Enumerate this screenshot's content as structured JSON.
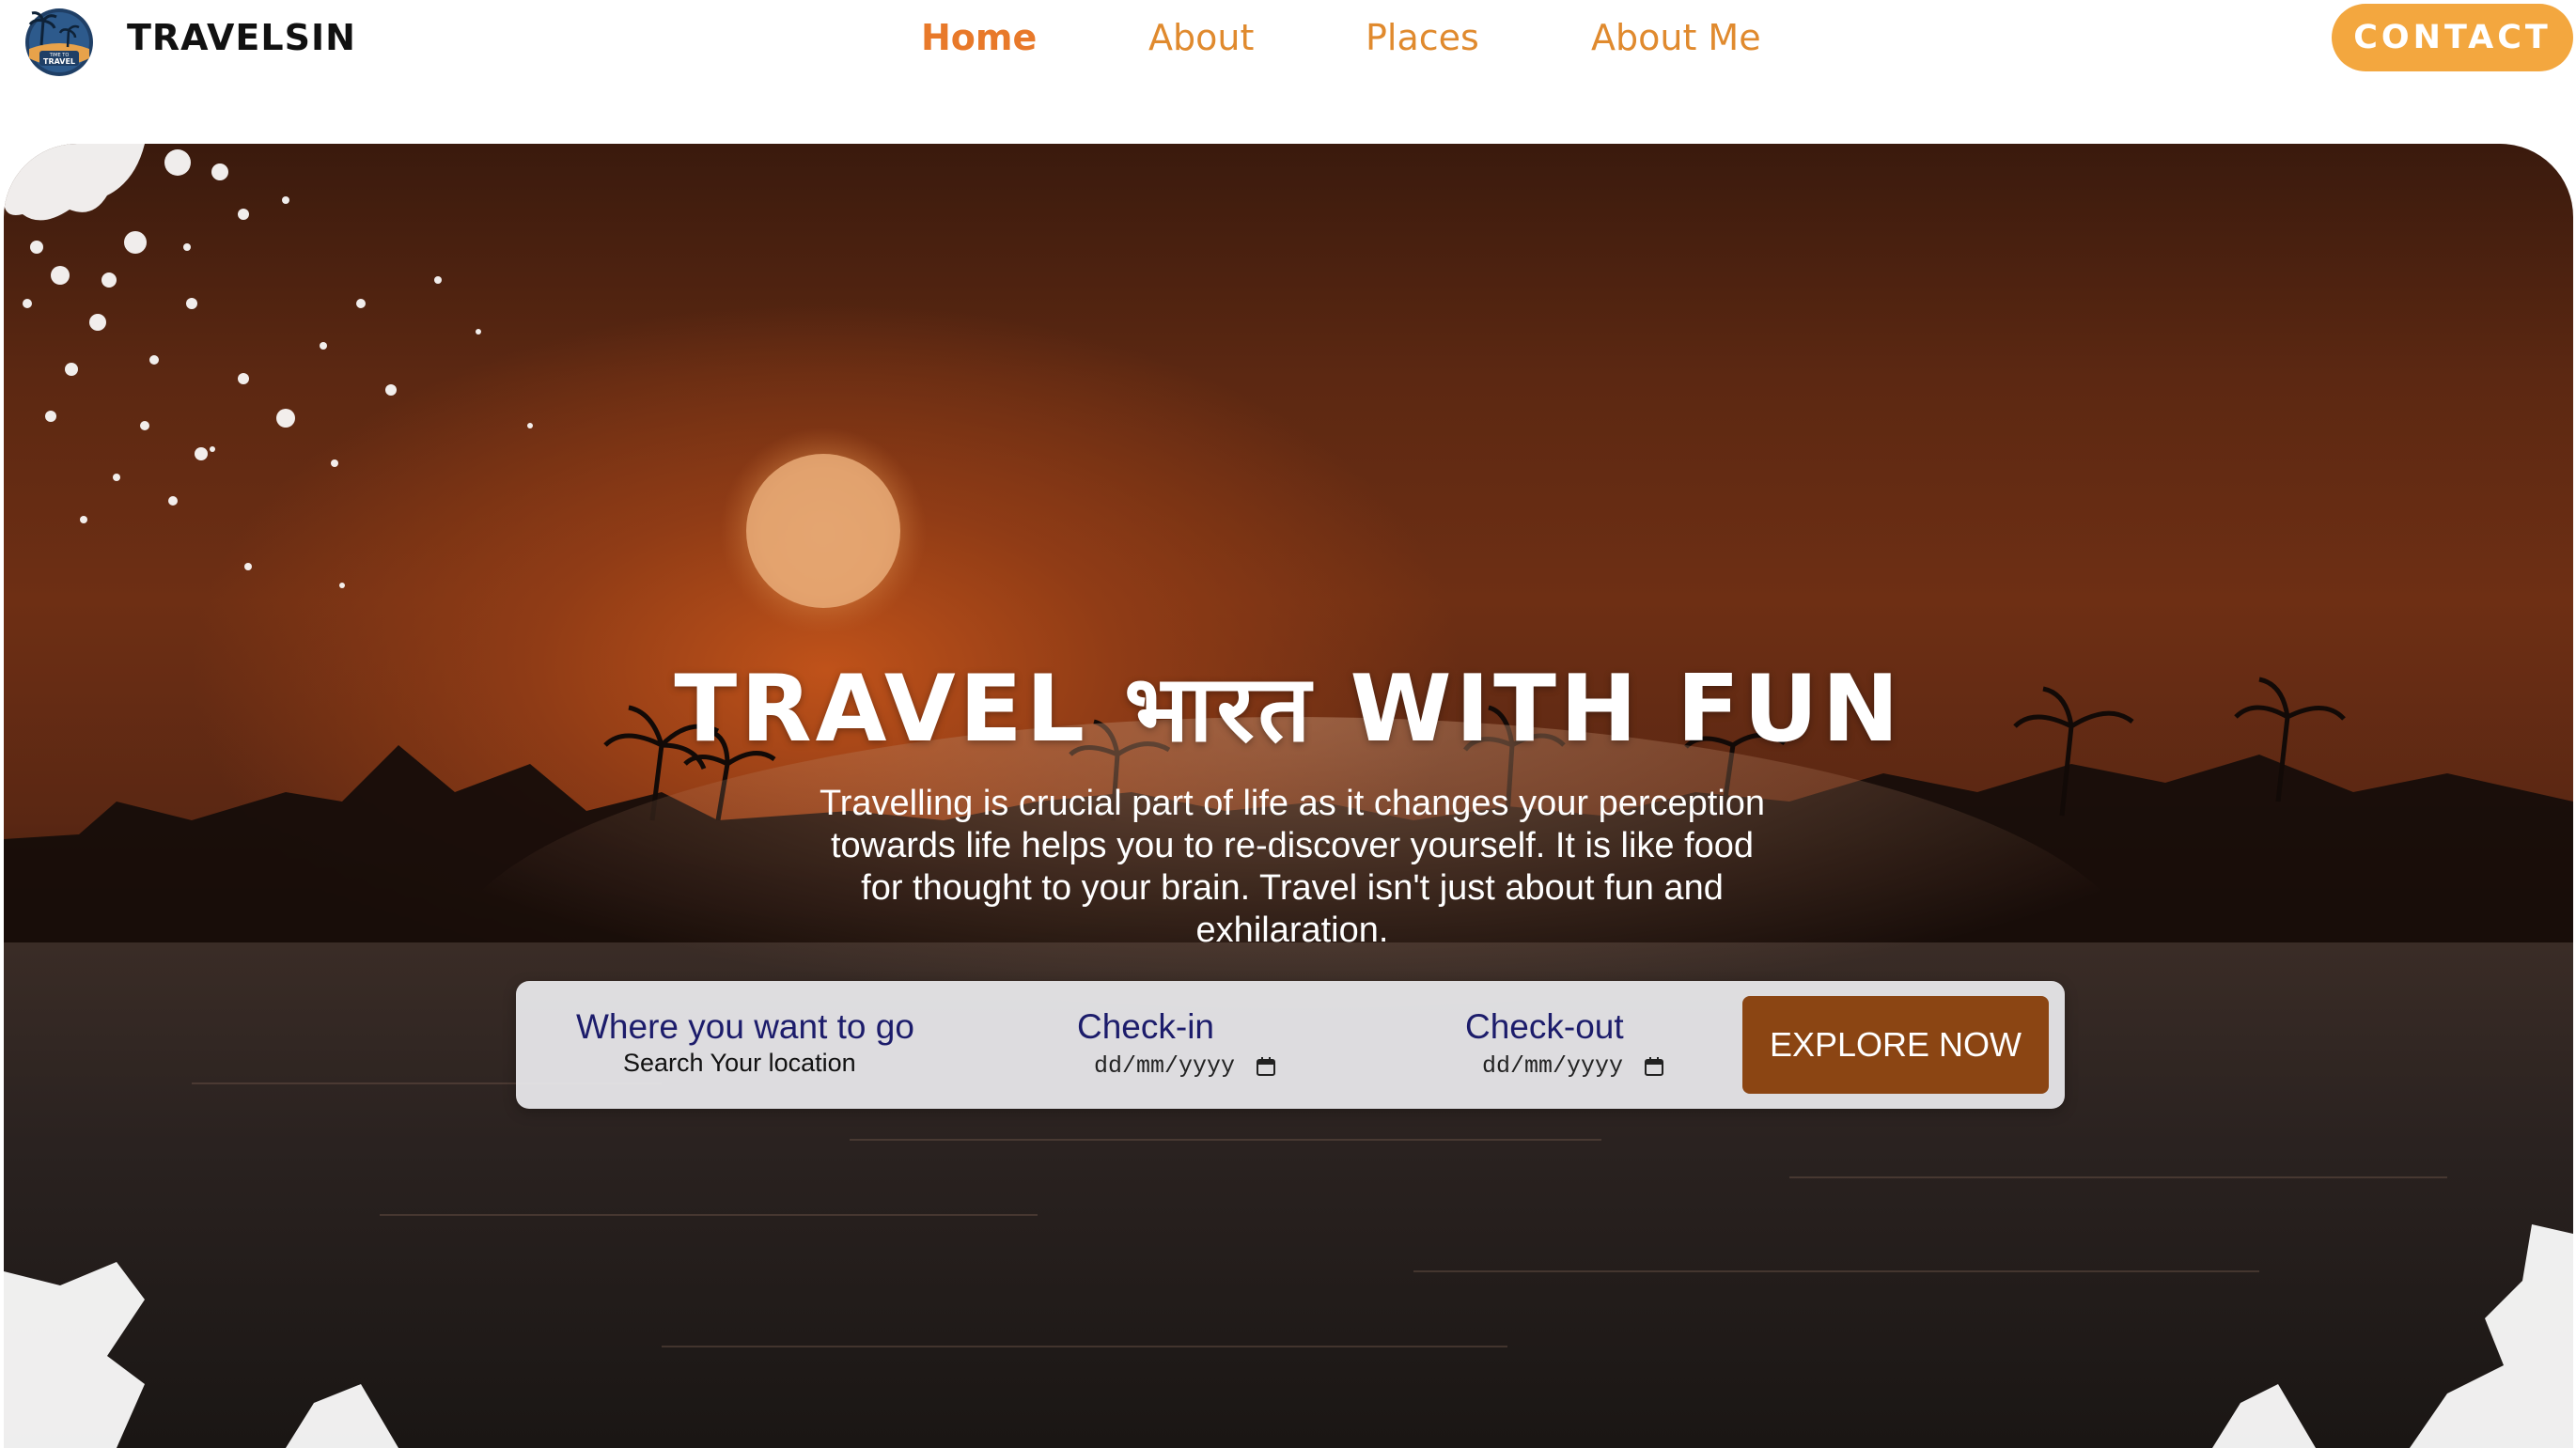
{
  "brand": {
    "name": "TRAVELSIN",
    "logo_text_top": "TIME TO",
    "logo_text_bottom": "TRAVEL"
  },
  "nav": {
    "items": [
      {
        "label": "Home",
        "active": true
      },
      {
        "label": "About",
        "active": false
      },
      {
        "label": "Places",
        "active": false
      },
      {
        "label": "About Me",
        "active": false
      }
    ],
    "contact_label": "CONTACT"
  },
  "hero": {
    "title": "TRAVEL भारत WITH FUN",
    "description": "Travelling is crucial part of life as it changes your perception towards life helps you to re-discover yourself. It is like food for thought to your brain. Travel isn't just about fun and exhilaration."
  },
  "search": {
    "location_label": "Where you want to go",
    "location_placeholder": "Search Your location",
    "checkin_label": "Check-in",
    "checkin_value": "dd/mm/yyyy",
    "checkout_label": "Check-out",
    "checkout_value": "dd/mm/yyyy",
    "explore_label": "EXPLORE NOW"
  },
  "colors": {
    "accent_orange": "#e8792a",
    "contact_bg": "#f3a73f",
    "explore_bg": "#8b4513",
    "label_navy": "#1c1c6b"
  },
  "icons": [
    "logo-badge-icon",
    "calendar-icon",
    "calendar-icon"
  ]
}
